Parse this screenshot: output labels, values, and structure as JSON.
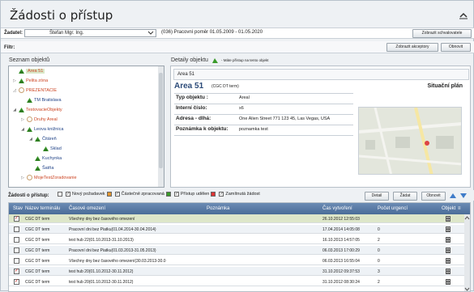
{
  "window": {
    "title": "Žádosti o přístup"
  },
  "header": {
    "zadatel_label": "Žadatel:",
    "zadatel_value": "Štefan Mgr. Ing.",
    "contract_text": "(036) Pracovní poměr 01.05.2009 - 01.05.2020",
    "btn_zobrazit_schvalovatele": "Zobrazit schvalovatele",
    "filtr_label": "Filtr:",
    "btn_zobrazit_akceptory": "Zobrazit akceptory",
    "btn_obnovit": "Obnovit"
  },
  "left": {
    "title": "Seznam objektů",
    "tree": [
      {
        "label": "Area 51",
        "color": "#cc4422",
        "icon": "green-icon"
      },
      {
        "label": "Pelita zóna",
        "color": "#cc4422",
        "icon": "green-icon"
      },
      {
        "label": "PREZENTACIE",
        "color": "#cc4422",
        "icon": "circle-icon"
      },
      {
        "label": "TM Bratislava",
        "color": "#224488",
        "icon": "green-icon"
      },
      {
        "label": "TestovacieObjekty",
        "color": "#cc4422",
        "icon": "green-icon"
      },
      {
        "label": "Druhy Areal",
        "color": "#cc4422",
        "icon": "circle-icon"
      },
      {
        "label": "Leova knižnica",
        "color": "#224488",
        "icon": "green-icon"
      },
      {
        "label": "Čitáreň",
        "color": "#224488",
        "icon": "green-icon"
      },
      {
        "label": "Sklad",
        "color": "#224488",
        "icon": "green-icon"
      },
      {
        "label": "Kuchynka",
        "color": "#224488",
        "icon": "green-icon"
      },
      {
        "label": "Šatňa",
        "color": "#224488",
        "icon": "green-icon"
      },
      {
        "label": "MojeTestZoradovanie",
        "color": "#cc4422",
        "icon": "circle-icon"
      }
    ]
  },
  "detail": {
    "title": "Detaily objektu",
    "legend": "- Máte přístup na tento objekt",
    "name_field": "Area 51",
    "heading": "Area 51",
    "heading_sub": "(CGC DT term)",
    "situacni_plan": "Situační plán",
    "rows": [
      {
        "label": "Typ objektu :",
        "value": "Areal"
      },
      {
        "label": "Interní číslo:",
        "value": "x6"
      },
      {
        "label": "Adresa - dlhá:",
        "value": "One Alien Street 771 123 45, Las Vegas, USA"
      },
      {
        "label": "Poznámka k objektu:",
        "value": "poznamka test"
      }
    ]
  },
  "requests": {
    "label": "Žádosti o přístup:",
    "filters": [
      "Nový požadavek",
      "Částečně zpracovaná",
      "Přístup udělen",
      "Zamítnutá žádost"
    ],
    "btn_detail": "Detail",
    "btn_zadat": "Žádat",
    "btn_obnovit": "Obnovit",
    "columns": [
      "Stav",
      "Název terminálu",
      "Časové omezení",
      "Poznámka",
      "Čas vytvoření",
      "Počet urgencí",
      "Objekt"
    ],
    "rows": [
      {
        "terminal": "CGC DT term",
        "limit": "Všechny dny bez časového omezení",
        "note": "",
        "created": "26.10.2012 12:55:03",
        "urgency": "",
        "checked": true
      },
      {
        "terminal": "CGC DT term",
        "limit": "Pracovní dni bez Piatku(01.04.2014-30.04.2014)",
        "note": "",
        "created": "17.04.2014 14:05:08",
        "urgency": "0",
        "checked": false
      },
      {
        "terminal": "CGC DT term",
        "limit": "test hub 22(01.10.2013-31.10.2013)",
        "note": "",
        "created": "16.10.2013 14:57:05",
        "urgency": "2",
        "checked": false
      },
      {
        "terminal": "CGC DT term",
        "limit": "Pracovní dni bez Piatku(01.03.2013-31.05.2013)",
        "note": "",
        "created": "06.03.2013 17:00:29",
        "urgency": "0",
        "checked": false
      },
      {
        "terminal": "CGC DT term",
        "limit": "Všechny dny bez časového omezení(30.03.2013-30.0",
        "note": "",
        "created": "06.03.2013 16:55:04",
        "urgency": "0",
        "checked": false
      },
      {
        "terminal": "CGC DT term",
        "limit": "test hub 20(01.10.2012-30.11.2012)",
        "note": "",
        "created": "31.10.2012 09:37:53",
        "urgency": "3",
        "checked": true
      },
      {
        "terminal": "CGC DT term",
        "limit": "test hub 20(01.10.2012-30.11.2012)",
        "note": "",
        "created": "31.10.2012 08:30:24",
        "urgency": "2",
        "checked": true
      }
    ]
  }
}
